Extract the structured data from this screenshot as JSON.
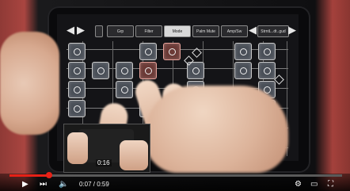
{
  "toolbar": {
    "buttons": [
      {
        "label": "Grp",
        "active": false
      },
      {
        "label": "Filter",
        "active": false
      },
      {
        "label": "Mode",
        "active": true
      },
      {
        "label": "Palm Mute",
        "active": false
      },
      {
        "label": "Amp/Sw",
        "active": false
      }
    ],
    "preset": "StrntL..dt..gud"
  },
  "player": {
    "current_time": "0:07",
    "duration": "0:59",
    "elapsed": "0:07 / 0:59",
    "preview_time": "0:16",
    "progress": 0.12
  },
  "icons": {
    "play": "play-icon",
    "next": "next-icon",
    "volume": "volume-icon",
    "settings": "settings-icon",
    "theater": "theater-icon",
    "fullscreen": "fullscreen-icon"
  },
  "colors": {
    "accent": "#e62117"
  }
}
